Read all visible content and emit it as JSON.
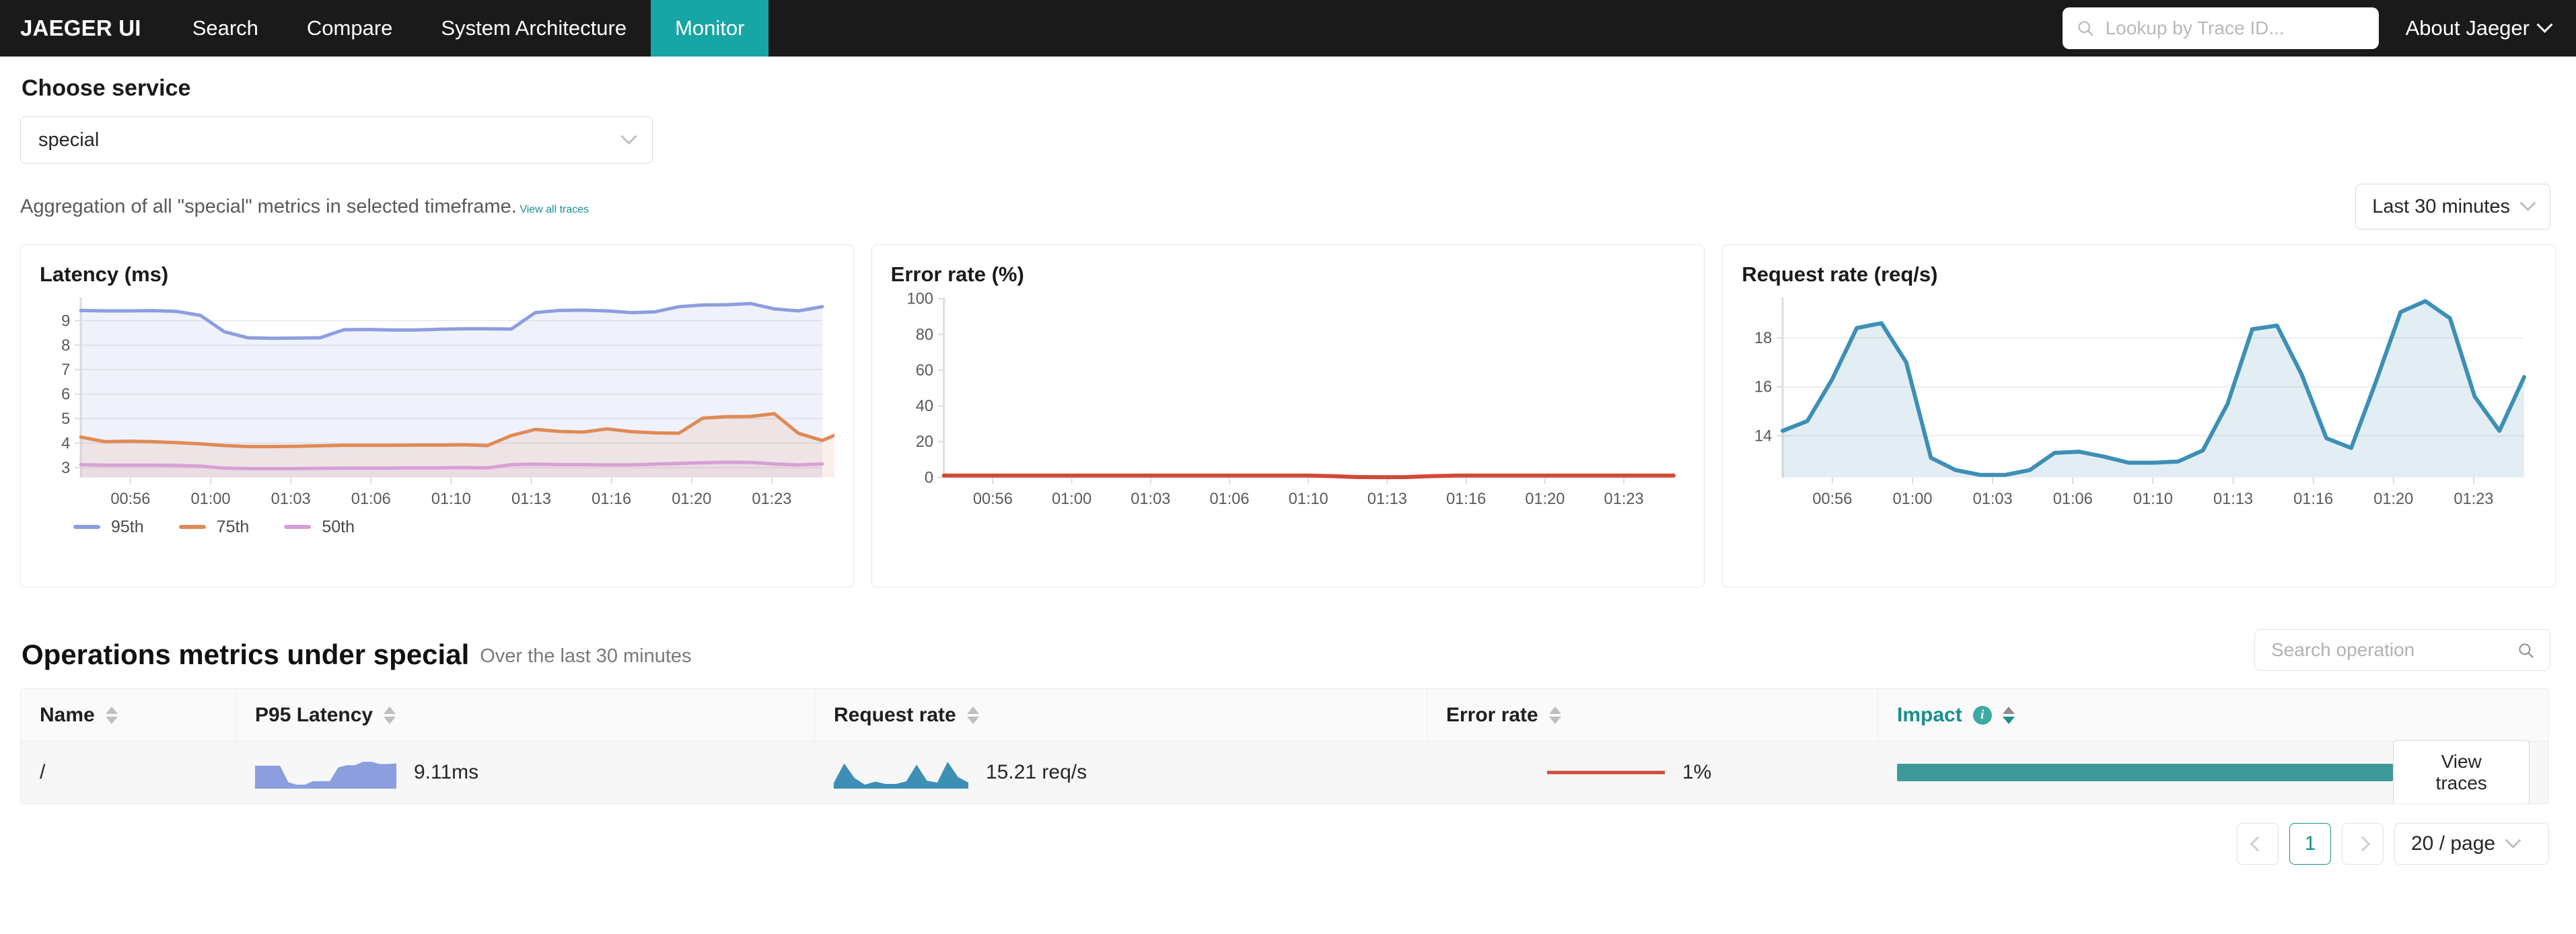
{
  "nav": {
    "brand": "JAEGER UI",
    "items": [
      {
        "label": "Search",
        "active": false
      },
      {
        "label": "Compare",
        "active": false
      },
      {
        "label": "System Architecture",
        "active": false
      },
      {
        "label": "Monitor",
        "active": true
      }
    ],
    "trace_search_placeholder": "Lookup by Trace ID...",
    "about": "About Jaeger"
  },
  "service": {
    "heading": "Choose service",
    "selected": "special"
  },
  "aggregation": {
    "text": "Aggregation of all \"special\" metrics in selected timeframe.",
    "link": "View all traces",
    "timeframe": "Last 30 minutes"
  },
  "operations": {
    "title": "Operations metrics under special",
    "subtitle": "Over the last 30 minutes",
    "search_placeholder": "Search operation",
    "columns": [
      {
        "label": "Name",
        "sorted": false
      },
      {
        "label": "P95 Latency",
        "sorted": false
      },
      {
        "label": "Request rate",
        "sorted": false
      },
      {
        "label": "Error rate",
        "sorted": false
      },
      {
        "label": "Impact",
        "sorted": true,
        "info": "i"
      }
    ],
    "rows": [
      {
        "name": "/",
        "p95_latency": "9.11ms",
        "request_rate": "15.21 req/s",
        "error_rate": "1%",
        "impact_pct": 97,
        "action": "View traces"
      }
    ]
  },
  "pagination": {
    "prev": "‹",
    "page": "1",
    "next": "›",
    "page_size": "20 / page"
  },
  "colors": {
    "accent": "#17908f",
    "nav_bg": "#1a1a1a",
    "p95": "#8c9ede",
    "p75": "#e08a54",
    "p50": "#d6a0d6",
    "error": "#d04a36",
    "request": "#3d8fb5",
    "impact_bar": "#3d9a98"
  },
  "chart_data": [
    {
      "type": "line",
      "title": "Latency (ms)",
      "xlabel": "",
      "ylabel": "",
      "ylim": [
        2.6,
        9.9
      ],
      "yticks": [
        3,
        4,
        5,
        6,
        7,
        8,
        9
      ],
      "xticks": [
        "00:56",
        "01:00",
        "01:03",
        "01:06",
        "01:10",
        "01:13",
        "01:16",
        "01:20",
        "01:23"
      ],
      "grid": true,
      "legend": [
        "95th",
        "75th",
        "50th"
      ],
      "legend_position": "bottom-left",
      "x": [
        "00:54",
        "00:55",
        "00:56",
        "00:57",
        "00:58",
        "00:59",
        "01:00",
        "01:01",
        "01:02",
        "01:03",
        "01:04",
        "01:05",
        "01:06",
        "01:07",
        "01:08",
        "01:09",
        "01:10",
        "01:11",
        "01:12",
        "01:13",
        "01:14",
        "01:15",
        "01:16",
        "01:17",
        "01:18",
        "01:19",
        "01:20",
        "01:21",
        "01:22",
        "01:23",
        "01:24"
      ],
      "series": [
        {
          "name": "95th",
          "color": "#8c9ede",
          "values": [
            9.42,
            9.4,
            9.4,
            9.41,
            9.38,
            9.22,
            8.55,
            8.3,
            8.28,
            8.29,
            8.3,
            8.63,
            8.64,
            8.62,
            8.62,
            8.65,
            8.67,
            8.67,
            8.66,
            9.33,
            9.42,
            9.43,
            9.4,
            9.33,
            9.36,
            9.57,
            9.64,
            9.65,
            9.7,
            9.48,
            9.4,
            9.57
          ]
        },
        {
          "name": "75th",
          "color": "#e08a54",
          "values": [
            4.25,
            4.06,
            4.08,
            4.06,
            4.02,
            3.97,
            3.9,
            3.86,
            3.86,
            3.87,
            3.89,
            3.91,
            3.91,
            3.91,
            3.92,
            3.92,
            3.93,
            3.9,
            4.31,
            4.56,
            4.48,
            4.45,
            4.58,
            4.47,
            4.42,
            4.4,
            5.02,
            5.08,
            5.09,
            5.2,
            4.4,
            4.11,
            4.52
          ]
        },
        {
          "name": "50th",
          "color": "#d6a0d6",
          "values": [
            3.12,
            3.1,
            3.1,
            3.1,
            3.09,
            3.06,
            2.98,
            2.96,
            2.96,
            2.96,
            2.97,
            2.98,
            2.98,
            2.98,
            2.99,
            2.99,
            3.0,
            2.99,
            3.12,
            3.14,
            3.12,
            3.12,
            3.11,
            3.11,
            3.14,
            3.17,
            3.2,
            3.22,
            3.21,
            3.15,
            3.11,
            3.15
          ]
        }
      ]
    },
    {
      "type": "line",
      "title": "Error rate (%)",
      "xlabel": "",
      "ylabel": "",
      "ylim": [
        0,
        100
      ],
      "yticks": [
        0,
        20,
        40,
        60,
        80,
        100
      ],
      "xticks": [
        "00:56",
        "01:00",
        "01:03",
        "01:06",
        "01:10",
        "01:13",
        "01:16",
        "01:20",
        "01:23"
      ],
      "grid": false,
      "series": [
        {
          "name": "error rate",
          "color": "#d04a36",
          "values": [
            1,
            1,
            1,
            1,
            1,
            1,
            1,
            1,
            1,
            1,
            1,
            1,
            1,
            1,
            1,
            1,
            0.7,
            0.2,
            0.1,
            0.2,
            0.7,
            1,
            1,
            1,
            1,
            1,
            1,
            1,
            1,
            1,
            1
          ]
        }
      ]
    },
    {
      "type": "area",
      "title": "Request rate (req/s)",
      "xlabel": "",
      "ylabel": "",
      "ylim": [
        12.3,
        19.6
      ],
      "yticks": [
        14,
        16,
        18
      ],
      "xticks": [
        "00:56",
        "01:00",
        "01:03",
        "01:06",
        "01:10",
        "01:13",
        "01:16",
        "01:20",
        "01:23"
      ],
      "grid": true,
      "series": [
        {
          "name": "req/s",
          "color": "#3d8fb5",
          "values": [
            14.2,
            14.6,
            16.3,
            18.4,
            18.6,
            17.0,
            13.1,
            12.6,
            12.4,
            12.4,
            12.6,
            13.3,
            13.35,
            13.15,
            12.9,
            12.9,
            12.95,
            13.4,
            15.3,
            18.35,
            18.5,
            16.5,
            13.9,
            13.5,
            16.2,
            19.05,
            19.5,
            18.8,
            15.6,
            14.2,
            16.4
          ]
        }
      ]
    },
    {
      "type": "sparkline",
      "title": "P95 Latency sparkline",
      "color": "#8c9ede",
      "values": [
        7.9,
        7.9,
        7.9,
        7.9,
        5.0,
        4.6,
        4.6,
        5.2,
        5.2,
        5.2,
        7.6,
        8.0,
        8.0,
        8.6,
        8.6,
        8.2,
        8.2,
        8.3
      ]
    },
    {
      "type": "sparkline",
      "title": "Request rate sparkline",
      "color": "#3d8fb5",
      "values": [
        2.5,
        8.4,
        4.0,
        2.0,
        2.9,
        2.2,
        2.2,
        3.0,
        8.0,
        3.2,
        2.6,
        8.9,
        4.3,
        2.6
      ]
    },
    {
      "type": "sparkline",
      "title": "Error rate sparkline",
      "color": "#d04a36",
      "values": [
        1,
        1,
        1,
        1,
        1,
        1,
        1,
        1,
        1,
        1,
        1,
        1
      ]
    }
  ]
}
